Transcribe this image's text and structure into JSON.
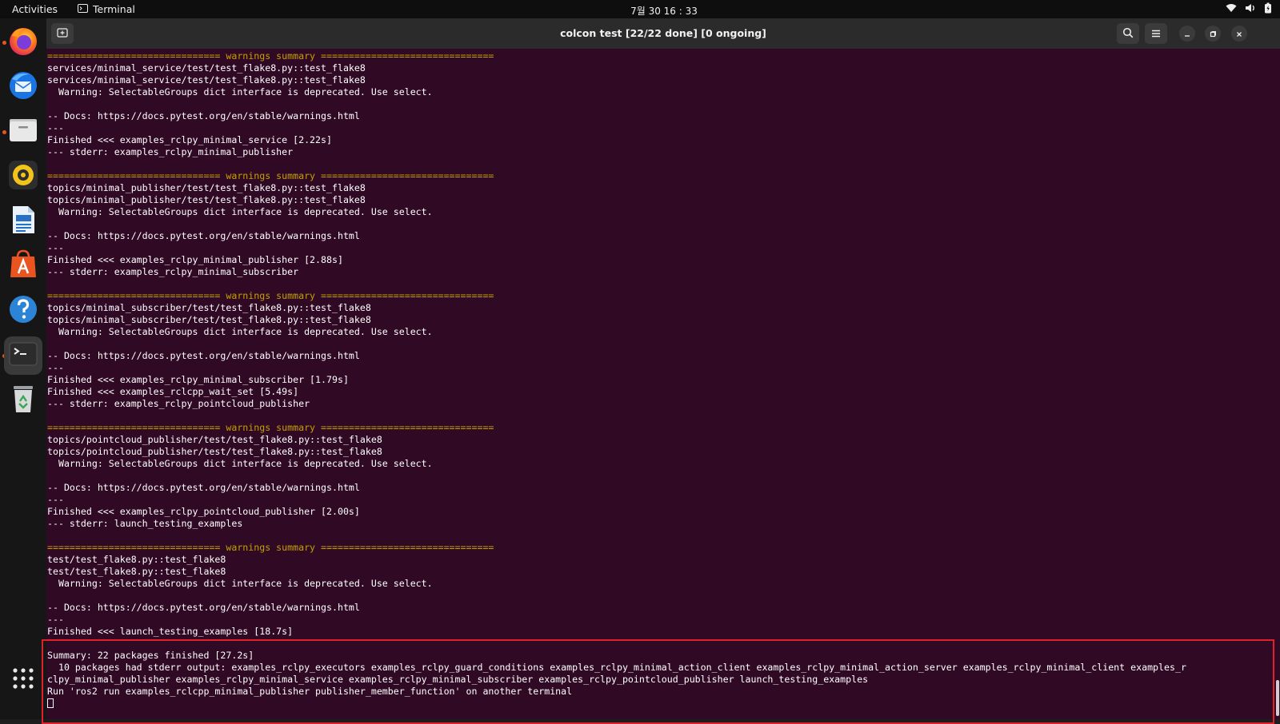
{
  "topbar": {
    "activities": "Activities",
    "app_name": "Terminal",
    "clock": "7월 30 16 : 33"
  },
  "dock": {
    "items": [
      {
        "name": "firefox-icon",
        "running": true
      },
      {
        "name": "thunderbird-icon",
        "running": false
      },
      {
        "name": "files-icon",
        "running": true
      },
      {
        "name": "rhythmbox-icon",
        "running": false
      },
      {
        "name": "libreoffice-writer-icon",
        "running": false
      },
      {
        "name": "app-center-icon",
        "running": false
      },
      {
        "name": "help-icon",
        "running": false
      },
      {
        "name": "terminal-icon",
        "running": true
      },
      {
        "name": "trash-icon",
        "running": false
      }
    ]
  },
  "window": {
    "title": "colcon test [22/22 done] [0 ongoing]"
  },
  "terminal": {
    "lines": [
      {
        "text": "=============================== warnings summary ===============================",
        "kind": "warn"
      },
      {
        "text": "services/minimal_service/test/test_flake8.py::test_flake8",
        "kind": "normal"
      },
      {
        "text": "services/minimal_service/test/test_flake8.py::test_flake8",
        "kind": "normal"
      },
      {
        "text": "  Warning: SelectableGroups dict interface is deprecated. Use select.",
        "kind": "normal"
      },
      {
        "text": "",
        "kind": "normal"
      },
      {
        "text": "-- Docs: https://docs.pytest.org/en/stable/warnings.html",
        "kind": "normal"
      },
      {
        "text": "---",
        "kind": "normal"
      },
      {
        "text": "Finished <<< examples_rclpy_minimal_service [2.22s]",
        "kind": "normal"
      },
      {
        "text": "--- stderr: examples_rclpy_minimal_publisher",
        "kind": "normal"
      },
      {
        "text": "",
        "kind": "normal"
      },
      {
        "text": "=============================== warnings summary ===============================",
        "kind": "warn"
      },
      {
        "text": "topics/minimal_publisher/test/test_flake8.py::test_flake8",
        "kind": "normal"
      },
      {
        "text": "topics/minimal_publisher/test/test_flake8.py::test_flake8",
        "kind": "normal"
      },
      {
        "text": "  Warning: SelectableGroups dict interface is deprecated. Use select.",
        "kind": "normal"
      },
      {
        "text": "",
        "kind": "normal"
      },
      {
        "text": "-- Docs: https://docs.pytest.org/en/stable/warnings.html",
        "kind": "normal"
      },
      {
        "text": "---",
        "kind": "normal"
      },
      {
        "text": "Finished <<< examples_rclpy_minimal_publisher [2.88s]",
        "kind": "normal"
      },
      {
        "text": "--- stderr: examples_rclpy_minimal_subscriber",
        "kind": "normal"
      },
      {
        "text": "",
        "kind": "normal"
      },
      {
        "text": "=============================== warnings summary ===============================",
        "kind": "warn"
      },
      {
        "text": "topics/minimal_subscriber/test/test_flake8.py::test_flake8",
        "kind": "normal"
      },
      {
        "text": "topics/minimal_subscriber/test/test_flake8.py::test_flake8",
        "kind": "normal"
      },
      {
        "text": "  Warning: SelectableGroups dict interface is deprecated. Use select.",
        "kind": "normal"
      },
      {
        "text": "",
        "kind": "normal"
      },
      {
        "text": "-- Docs: https://docs.pytest.org/en/stable/warnings.html",
        "kind": "normal"
      },
      {
        "text": "---",
        "kind": "normal"
      },
      {
        "text": "Finished <<< examples_rclpy_minimal_subscriber [1.79s]",
        "kind": "normal"
      },
      {
        "text": "Finished <<< examples_rclcpp_wait_set [5.49s]",
        "kind": "normal"
      },
      {
        "text": "--- stderr: examples_rclpy_pointcloud_publisher",
        "kind": "normal"
      },
      {
        "text": "",
        "kind": "normal"
      },
      {
        "text": "=============================== warnings summary ===============================",
        "kind": "warn"
      },
      {
        "text": "topics/pointcloud_publisher/test/test_flake8.py::test_flake8",
        "kind": "normal"
      },
      {
        "text": "topics/pointcloud_publisher/test/test_flake8.py::test_flake8",
        "kind": "normal"
      },
      {
        "text": "  Warning: SelectableGroups dict interface is deprecated. Use select.",
        "kind": "normal"
      },
      {
        "text": "",
        "kind": "normal"
      },
      {
        "text": "-- Docs: https://docs.pytest.org/en/stable/warnings.html",
        "kind": "normal"
      },
      {
        "text": "---",
        "kind": "normal"
      },
      {
        "text": "Finished <<< examples_rclpy_pointcloud_publisher [2.00s]",
        "kind": "normal"
      },
      {
        "text": "--- stderr: launch_testing_examples",
        "kind": "normal"
      },
      {
        "text": "",
        "kind": "normal"
      },
      {
        "text": "=============================== warnings summary ===============================",
        "kind": "warn"
      },
      {
        "text": "test/test_flake8.py::test_flake8",
        "kind": "normal"
      },
      {
        "text": "test/test_flake8.py::test_flake8",
        "kind": "normal"
      },
      {
        "text": "  Warning: SelectableGroups dict interface is deprecated. Use select.",
        "kind": "normal"
      },
      {
        "text": "",
        "kind": "normal"
      },
      {
        "text": "-- Docs: https://docs.pytest.org/en/stable/warnings.html",
        "kind": "normal"
      },
      {
        "text": "---",
        "kind": "normal"
      },
      {
        "text": "Finished <<< launch_testing_examples [18.7s]",
        "kind": "normal"
      },
      {
        "text": "",
        "kind": "normal"
      },
      {
        "text": "Summary: 22 packages finished [27.2s]",
        "kind": "normal"
      },
      {
        "text": "  10 packages had stderr output: examples_rclpy_executors examples_rclpy_guard_conditions examples_rclpy_minimal_action_client examples_rclpy_minimal_action_server examples_rclpy_minimal_client examples_r",
        "kind": "normal"
      },
      {
        "text": "clpy_minimal_publisher examples_rclpy_minimal_service examples_rclpy_minimal_subscriber examples_rclpy_pointcloud_publisher launch_testing_examples",
        "kind": "normal"
      },
      {
        "text": "Run 'ros2 run examples_rclcpp_minimal_publisher publisher_member_function' on another terminal",
        "kind": "normal"
      }
    ]
  }
}
